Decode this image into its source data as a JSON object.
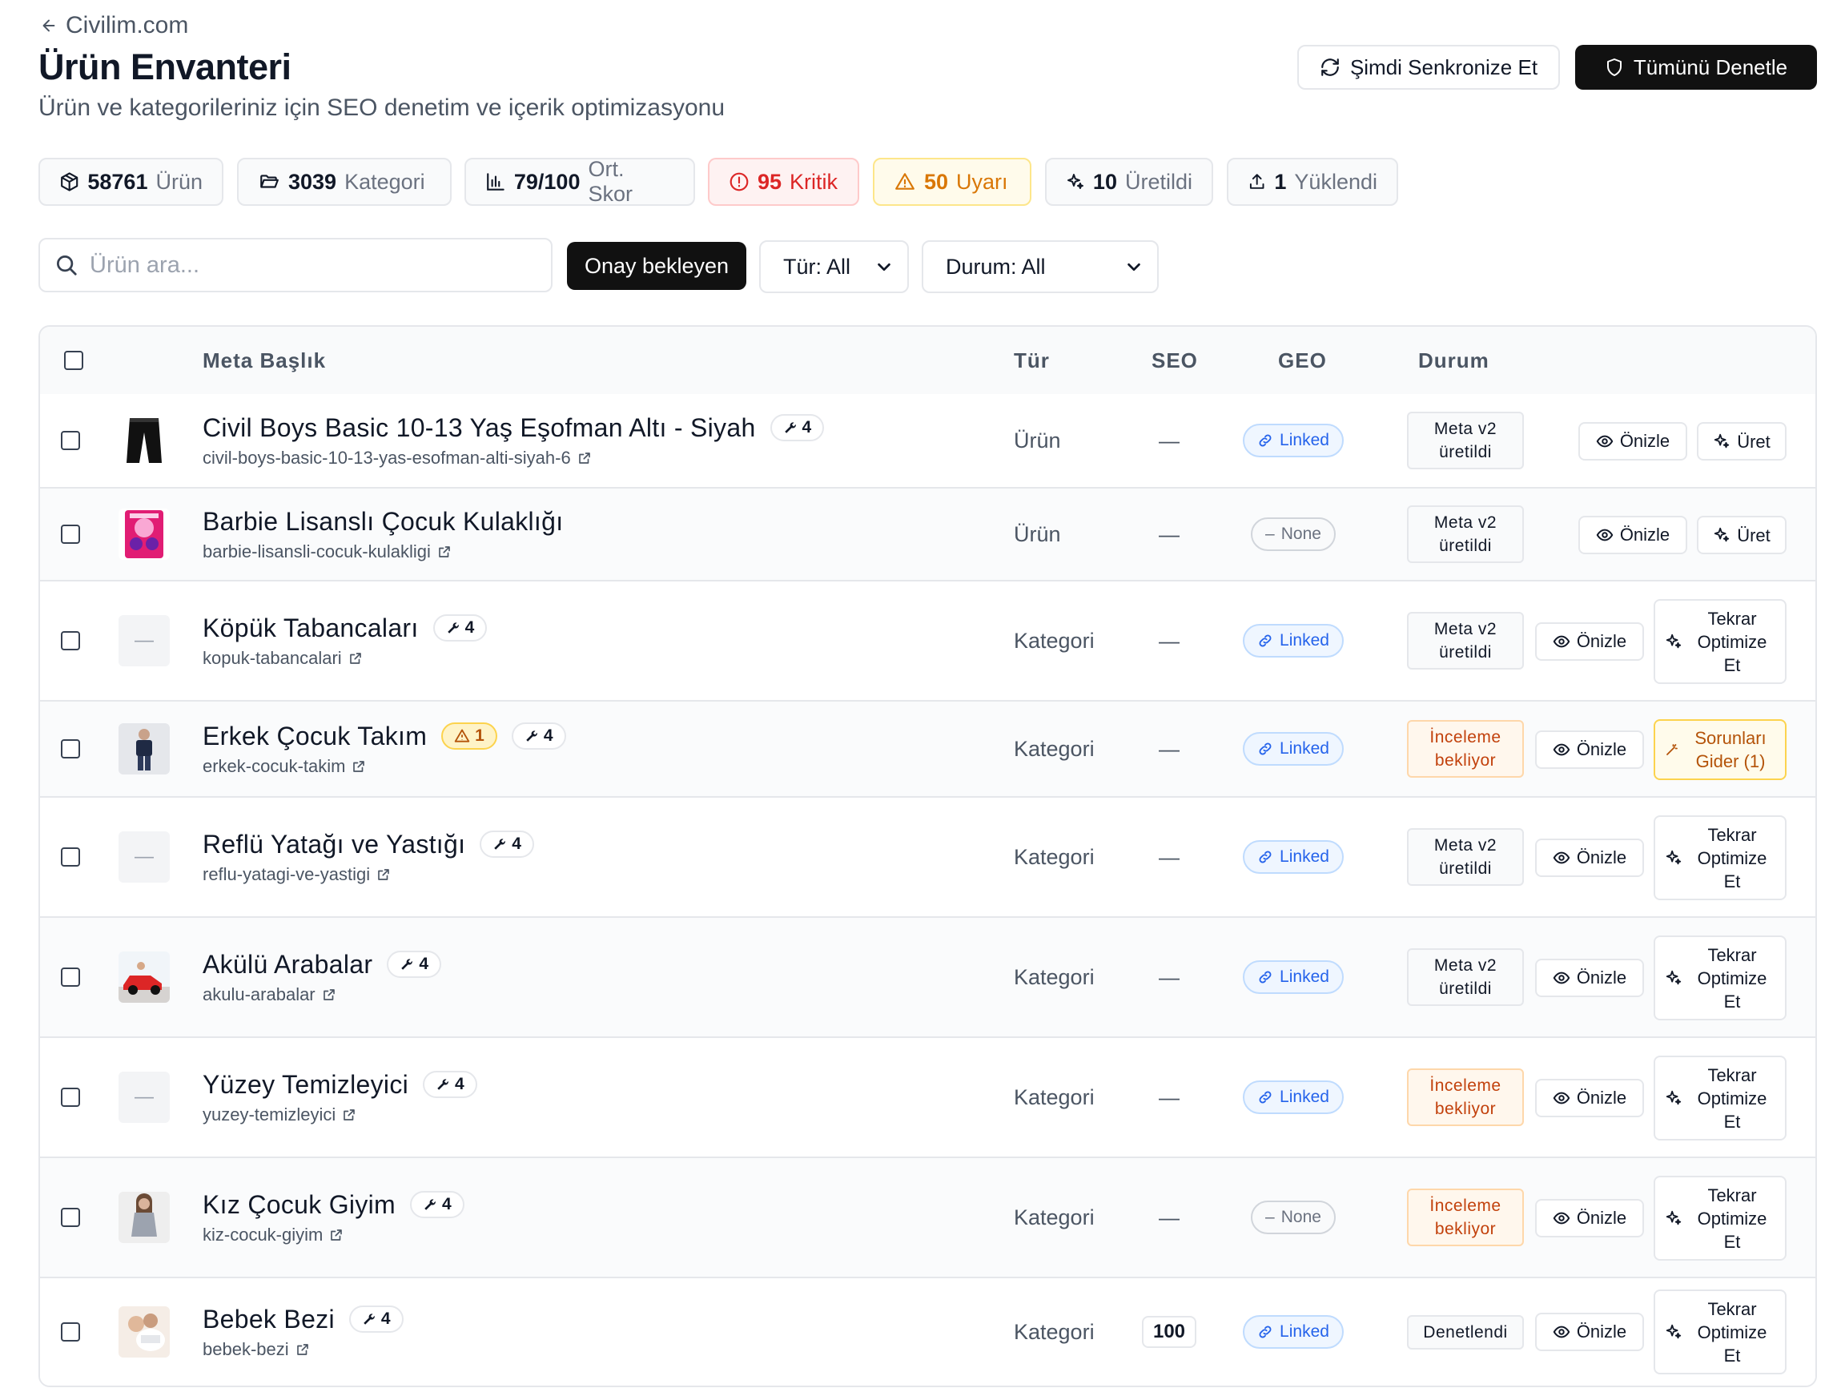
{
  "header": {
    "back_label": "Civilim.com",
    "title": "Ürün Envanteri",
    "subtitle": "Ürün ve kategorileriniz için SEO denetim ve içerik optimizasyonu",
    "sync_label": "Şimdi Senkronize Et",
    "audit_label": "Tümünü Denetle"
  },
  "stats": {
    "products": {
      "num": "58761",
      "label": "Ürün"
    },
    "categories": {
      "num": "3039",
      "label": "Kategori"
    },
    "score": {
      "num": "79/100",
      "label": "Ort. Skor"
    },
    "critical": {
      "num": "95",
      "label": "Kritik"
    },
    "warning": {
      "num": "50",
      "label": "Uyarı"
    },
    "generated": {
      "num": "10",
      "label": "Üretildi"
    },
    "uploaded": {
      "num": "1",
      "label": "Yüklendi"
    }
  },
  "filters": {
    "search_placeholder": "Ürün ara...",
    "pending_label": "Onay bekleyen",
    "type_select": "Tür: All",
    "status_select": "Durum: All"
  },
  "table": {
    "headers": {
      "title": "Meta Başlık",
      "type": "Tür",
      "seo": "SEO",
      "geo": "GEO",
      "status": "Durum"
    },
    "rows": [
      {
        "name": "Civil Boys Basic 10-13 Yaş Eşofman Altı - Siyah",
        "slug": "civil-boys-basic-10-13-yas-esofman-alti-siyah-6",
        "chip": "4",
        "warn": "",
        "type": "Ürün",
        "seo": "—",
        "geo": "Linked",
        "status": "Meta v2 üretildi",
        "btn1": "Önizle",
        "btn2": "Üret",
        "thumb": "pants"
      },
      {
        "name": "Barbie Lisanslı Çocuk Kulaklığı",
        "slug": "barbie-lisansli-cocuk-kulakligi",
        "chip": "",
        "warn": "",
        "type": "Ürün",
        "seo": "—",
        "geo": "None",
        "status": "Meta v2 üretildi",
        "btn1": "Önizle",
        "btn2": "Üret",
        "thumb": "barbie"
      },
      {
        "name": "Köpük Tabancaları",
        "slug": "kopuk-tabancalari",
        "chip": "4",
        "warn": "",
        "type": "Kategori",
        "seo": "—",
        "geo": "Linked",
        "status": "Meta v2 üretildi",
        "btn1": "Önizle",
        "btn2": "Tekrar Optimize Et",
        "thumb": "empty",
        "empty_text": "—"
      },
      {
        "name": "Erkek Çocuk Takım",
        "slug": "erkek-cocuk-takim",
        "chip": "4",
        "warn": "1",
        "type": "Kategori",
        "seo": "—",
        "geo": "Linked",
        "status": "İnceleme bekliyor",
        "btn1": "Önizle",
        "btn2": "Sorunları Gider (1)",
        "thumb": "boy"
      },
      {
        "name": "Reflü Yatağı ve Yastığı",
        "slug": "reflu-yatagi-ve-yastigi",
        "chip": "4",
        "warn": "",
        "type": "Kategori",
        "seo": "—",
        "geo": "Linked",
        "status": "Meta v2 üretildi",
        "btn1": "Önizle",
        "btn2": "Tekrar Optimize Et",
        "thumb": "empty",
        "empty_text": "—"
      },
      {
        "name": "Akülü Arabalar",
        "slug": "akulu-arabalar",
        "chip": "4",
        "warn": "",
        "type": "Kategori",
        "seo": "—",
        "geo": "Linked",
        "status": "Meta v2 üretildi",
        "btn1": "Önizle",
        "btn2": "Tekrar Optimize Et",
        "thumb": "car"
      },
      {
        "name": "Yüzey Temizleyici",
        "slug": "yuzey-temizleyici",
        "chip": "4",
        "warn": "",
        "type": "Kategori",
        "seo": "—",
        "geo": "Linked",
        "status": "İnceleme bekliyor",
        "btn1": "Önizle",
        "btn2": "Tekrar Optimize Et",
        "thumb": "empty",
        "empty_text": "—"
      },
      {
        "name": "Kız Çocuk Giyim",
        "slug": "kiz-cocuk-giyim",
        "chip": "4",
        "warn": "",
        "type": "Kategori",
        "seo": "—",
        "geo": "None",
        "status": "İnceleme bekliyor",
        "btn1": "Önizle",
        "btn2": "Tekrar Optimize Et",
        "thumb": "girl"
      },
      {
        "name": "Bebek Bezi",
        "slug": "bebek-bezi",
        "chip": "4",
        "warn": "",
        "type": "Kategori",
        "seo": "100",
        "geo": "Linked",
        "status": "Denetlendi",
        "btn1": "Önizle",
        "btn2": "Tekrar Optimize Et",
        "thumb": "baby"
      }
    ]
  },
  "colors": {
    "accent_dark": "#111111",
    "critical": "#dc2626",
    "warning": "#d97706",
    "linked": "#2563eb",
    "pending": "#c2410c"
  }
}
